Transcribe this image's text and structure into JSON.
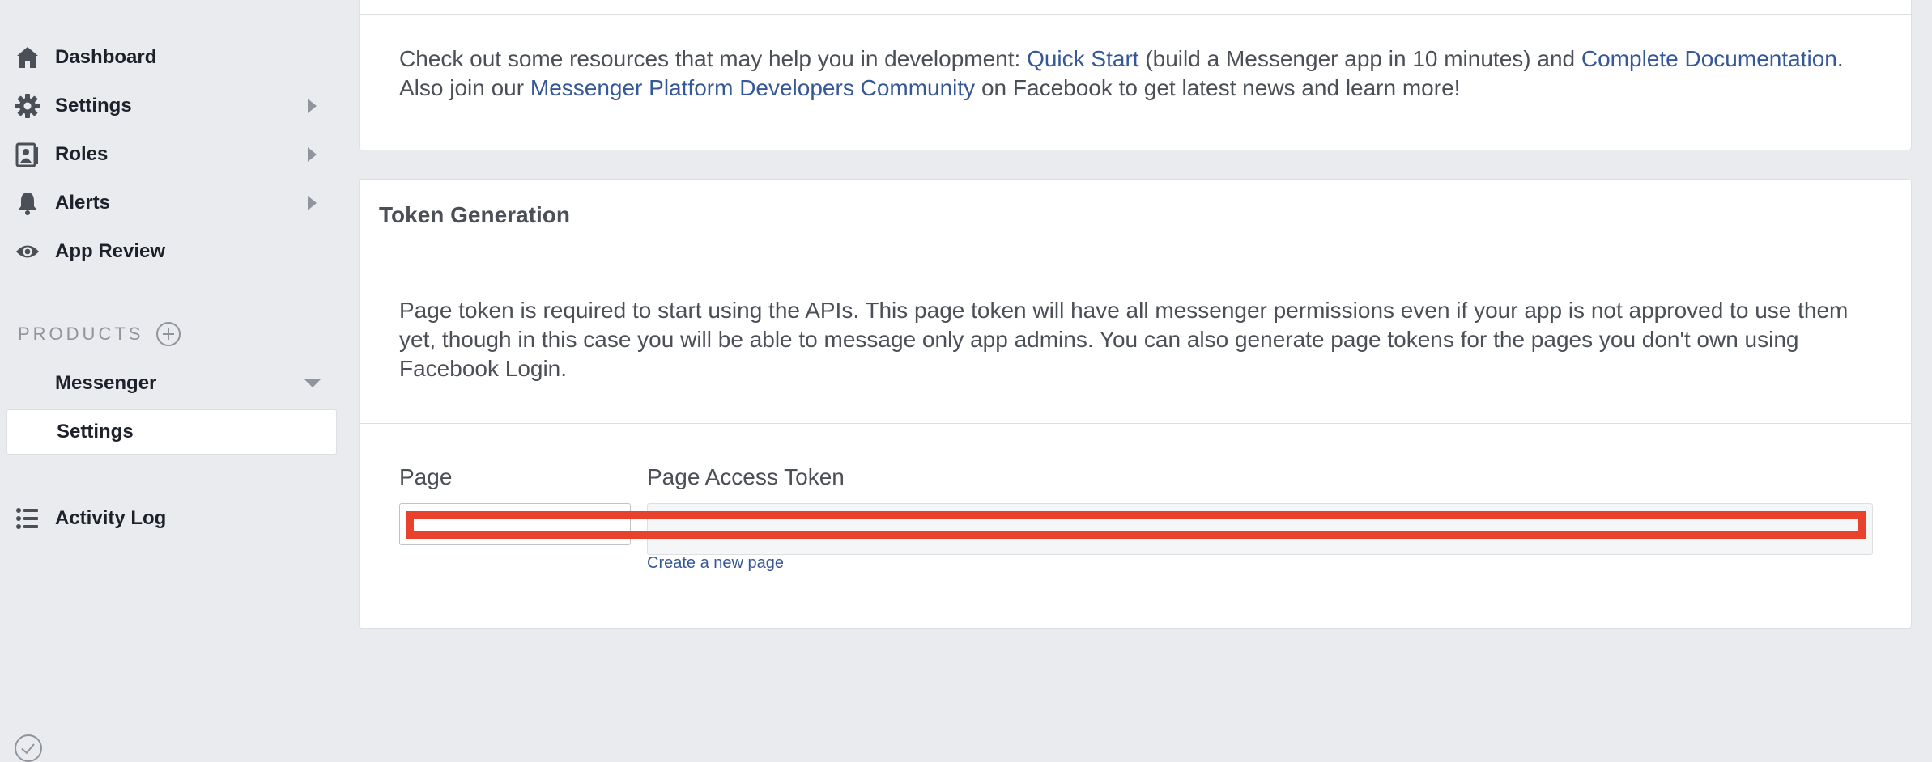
{
  "sidebar": {
    "items": [
      {
        "label": "Dashboard",
        "icon": "home-icon"
      },
      {
        "label": "Settings",
        "icon": "gear-icon"
      },
      {
        "label": "Roles",
        "icon": "roles-icon"
      },
      {
        "label": "Alerts",
        "icon": "bell-icon"
      },
      {
        "label": "App Review",
        "icon": "eye-icon"
      }
    ],
    "products_header": "PRODUCTS",
    "product": {
      "label": "Messenger",
      "sub_item": "Settings"
    },
    "activity_log": "Activity Log"
  },
  "resources_card": {
    "text_1": "Check out some resources that may help you in development: ",
    "link_quick_start": "Quick Start",
    "text_2": " (build a Messenger app in 10 minutes) and ",
    "link_docs": "Complete Documentation",
    "text_3": ". Also join our ",
    "link_community": "Messenger Platform Developers Community",
    "text_4": " on Facebook to get latest news and learn more!"
  },
  "token_card": {
    "title": "Token Generation",
    "description": "Page token is required to start using the APIs. This page token will have all messenger permissions even if your app is not approved to use them yet, though in this case you will be able to message only app admins. You can also generate page tokens for the pages you don't own using Facebook Login.",
    "page_label": "Page",
    "token_label": "Page Access Token",
    "create_link": "Create a new page"
  },
  "colors": {
    "link": "#365899",
    "redaction": "#e8412c",
    "background": "#e9ebee"
  }
}
